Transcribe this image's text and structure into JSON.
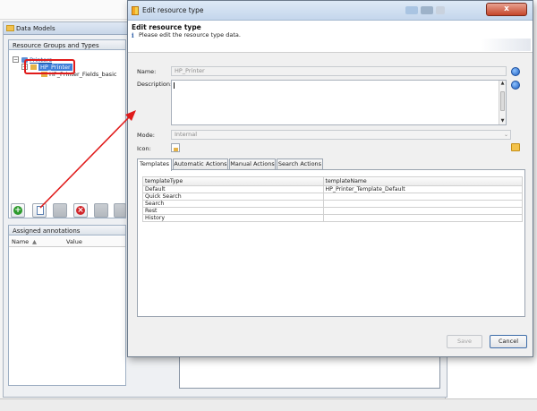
{
  "background": {
    "window_title": "Data Models",
    "resource_panel": {
      "title": "Resource Groups and Types",
      "tree": [
        {
          "label": "Printers",
          "level": 0
        },
        {
          "label": "HP_Printer",
          "level": 1,
          "selected": true
        },
        {
          "label": "HP_Printer_Fields_basic",
          "level": 2
        }
      ]
    },
    "annotations_panel": {
      "title": "Assigned annotations",
      "columns": [
        "Name",
        "Value"
      ],
      "sort_indicator": "▲"
    }
  },
  "dialog": {
    "window_title": "Edit resource type",
    "header": {
      "title": "Edit resource type",
      "subtitle": "Please edit the resource type data.",
      "info_glyph": "i"
    },
    "fields": {
      "name_label": "Name:",
      "name_value": "HP_Printer",
      "description_label": "Description:",
      "description_value": "",
      "mode_label": "Mode:",
      "mode_value": "Internal",
      "icon_label": "Icon:"
    },
    "tabs": [
      {
        "label": "Templates",
        "active": true
      },
      {
        "label": "Automatic Actions",
        "active": false
      },
      {
        "label": "Manual Actions",
        "active": false
      },
      {
        "label": "Search Actions",
        "active": false
      }
    ],
    "grid": {
      "columns": [
        "templateType",
        "templateName"
      ],
      "rows": [
        [
          "Default",
          "HP_Printer_Template_Default"
        ],
        [
          "Quick Search",
          ""
        ],
        [
          "Search",
          ""
        ],
        [
          "Rest",
          ""
        ],
        [
          "History",
          ""
        ]
      ]
    },
    "buttons": {
      "save": "Save",
      "cancel": "Cancel",
      "close_glyph": "x"
    }
  },
  "colors": {
    "selection": "#3d7ed8",
    "highlight_box": "#e01b1b",
    "arrow": "#e01b1b",
    "add_button": "#2c9a2c",
    "delete_button": "#d1262b"
  }
}
